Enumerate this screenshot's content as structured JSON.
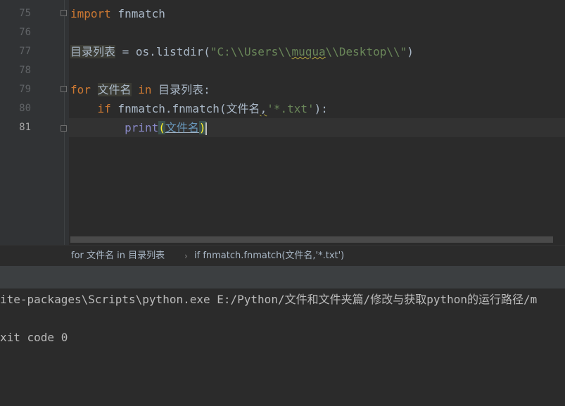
{
  "editor": {
    "line_numbers": [
      "75",
      "76",
      "77",
      "78",
      "79",
      "80",
      "81"
    ],
    "lines": {
      "l75": {
        "kw_import": "import",
        "module": " fnmatch"
      },
      "l77": {
        "var": "目录列表",
        "assign": " = os.listdir(",
        "str_a": "\"C:\\\\Users\\\\",
        "str_user": "muqua",
        "str_b": "\\\\Desktop\\\\\"",
        "close": ")"
      },
      "l79": {
        "kw_for": "for",
        "sp1": " ",
        "loop_var": "文件名",
        "sp2": " ",
        "kw_in": "in",
        "rest": " 目录列表:"
      },
      "l80": {
        "indent": "    ",
        "kw_if": "if",
        "call": " fnmatch.fnmatch(文件名",
        "comma": ",",
        "str_pattern": "'*.txt'",
        "close": "):"
      },
      "l81": {
        "indent": "        ",
        "func": "print",
        "open": "(",
        "arg": "文件名",
        "close": ")"
      }
    }
  },
  "breadcrumb": {
    "item1": "for 文件名 in 目录列表",
    "separator": "›",
    "item2": "if fnmatch.fnmatch(文件名,'*.txt')"
  },
  "console": {
    "line1": "ite-packages\\Scripts\\python.exe E:/Python/文件和文件夹篇/修改与获取python的运行路径/m",
    "line2": "xit code 0"
  },
  "colors": {
    "background": "#2b2b2b",
    "gutter": "#313335",
    "keyword": "#cc7832",
    "string": "#6a8759",
    "builtin": "#8888c6",
    "text": "#a9b7c6"
  }
}
